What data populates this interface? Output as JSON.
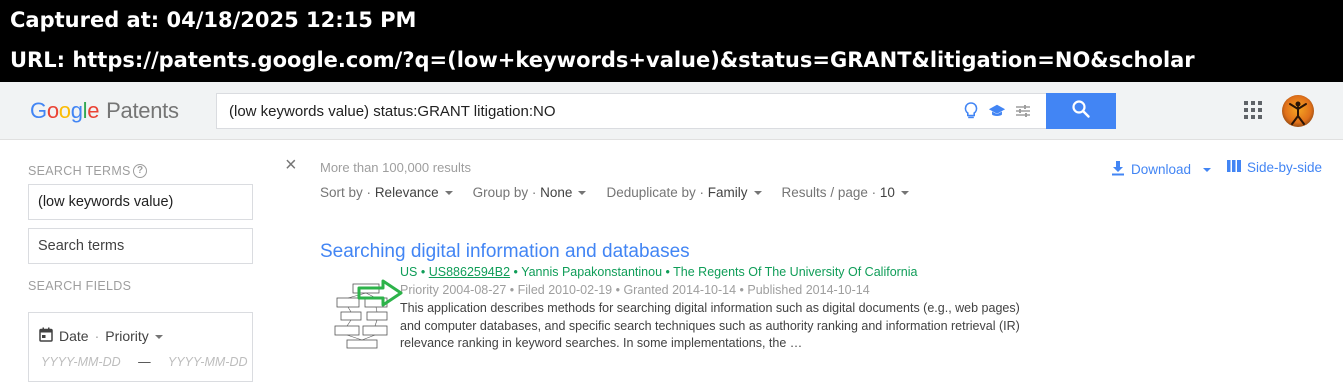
{
  "capture": {
    "captured_at": "Captured at: 04/18/2025 12:15 PM",
    "url": "URL: https://patents.google.com/?q=(low+keywords+value)&status=GRANT&litigation=NO&scholar"
  },
  "header": {
    "logo_letters": [
      "G",
      "o",
      "o",
      "g",
      "l",
      "e"
    ],
    "logo_product": "Patents",
    "search_query": "(low keywords value) status:GRANT litigation:NO",
    "icons": [
      "lightbulb-icon",
      "scholar-icon",
      "tune-icon",
      "search-icon",
      "apps-icon"
    ]
  },
  "left_panel": {
    "search_terms_label": "SEARCH TERMS",
    "term_chip": "(low keywords value)",
    "term_placeholder": "Search terms",
    "search_fields_label": "SEARCH FIELDS",
    "date_label": "Date",
    "date_sep": "·",
    "date_type": "Priority",
    "date_from_placeholder": "YYYY-MM-DD",
    "date_dash": "—",
    "date_to_placeholder": "YYYY-MM-DD"
  },
  "results_header": {
    "close": "×",
    "count": "More than 100,000 results",
    "sort_label": "Sort by",
    "sort_value": "Relevance",
    "group_label": "Group by",
    "group_value": "None",
    "dedup_label": "Deduplicate by",
    "dedup_value": "Family",
    "perpage_label": "Results / page",
    "perpage_value": "10",
    "sep": "·",
    "download": "Download",
    "side_by_side": "Side-by-side"
  },
  "result": {
    "title": "Searching digital information and databases",
    "country": "US",
    "dot": "•",
    "patent_number": "US8862594B2",
    "inventor": "Yannis Papakonstantinou",
    "assignee": "The Regents Of The University Of California",
    "dates": "Priority 2004-08-27 • Filed 2010-02-19 • Granted 2014-10-14 • Published 2014-10-14",
    "snippet": "This application describes methods for searching digital information such as digital documents (e.g., web pages) and computer databases, and specific search techniques such as authority ranking and information retrieval (IR) relevance ranking in keyword searches. In some implementations, the …"
  },
  "colors": {
    "accent": "#4285f4",
    "green": "#0f9d58",
    "annotation_arrow": "#2db34a"
  }
}
